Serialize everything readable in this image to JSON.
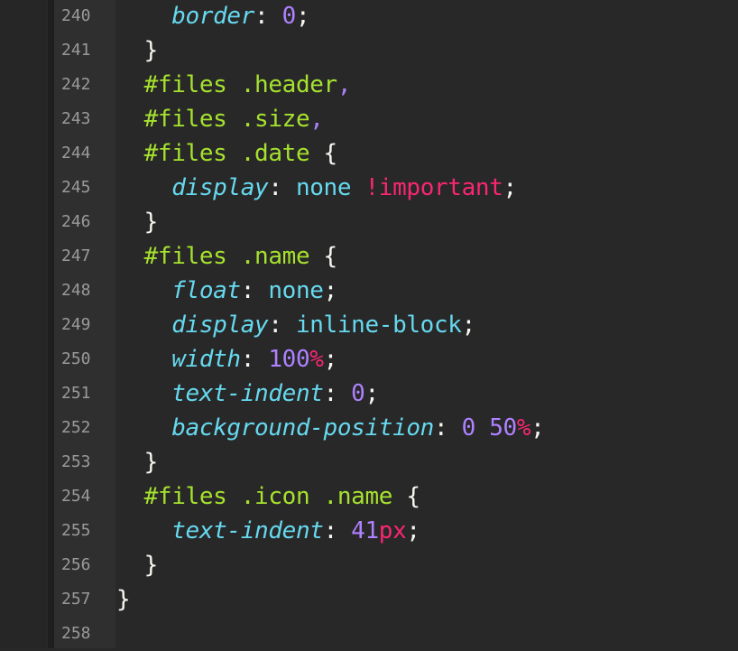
{
  "editor": {
    "colors": {
      "background": "#282828",
      "gutter": "#2f2f2f",
      "line_number": "#9a9a9a",
      "selector": "#a6e22e",
      "property": "#66d9ef",
      "number": "#ae81ff",
      "keyword": "#f92672",
      "punctuation": "#f8f8f2"
    },
    "lines": [
      {
        "num": "240",
        "indent": "    ",
        "tokens": [
          {
            "t": "prop",
            "v": "border"
          },
          {
            "t": "punc",
            "v": ": "
          },
          {
            "t": "num",
            "v": "0"
          },
          {
            "t": "punc",
            "v": ";"
          }
        ]
      },
      {
        "num": "241",
        "indent": "  ",
        "tokens": [
          {
            "t": "punc",
            "v": "}"
          }
        ]
      },
      {
        "num": "242",
        "indent": "  ",
        "tokens": [
          {
            "t": "sel",
            "v": "#files .header"
          },
          {
            "t": "comma",
            "v": ","
          }
        ]
      },
      {
        "num": "243",
        "indent": "  ",
        "tokens": [
          {
            "t": "sel",
            "v": "#files .size"
          },
          {
            "t": "comma",
            "v": ","
          }
        ]
      },
      {
        "num": "244",
        "indent": "  ",
        "tokens": [
          {
            "t": "sel",
            "v": "#files .date"
          },
          {
            "t": "punc",
            "v": " {"
          }
        ]
      },
      {
        "num": "245",
        "indent": "    ",
        "tokens": [
          {
            "t": "prop",
            "v": "display"
          },
          {
            "t": "punc",
            "v": ": "
          },
          {
            "t": "val",
            "v": "none"
          },
          {
            "t": "punc",
            "v": " "
          },
          {
            "t": "kw",
            "v": "!important"
          },
          {
            "t": "punc",
            "v": ";"
          }
        ]
      },
      {
        "num": "246",
        "indent": "  ",
        "tokens": [
          {
            "t": "punc",
            "v": "}"
          }
        ]
      },
      {
        "num": "247",
        "indent": "  ",
        "tokens": [
          {
            "t": "sel",
            "v": "#files .name"
          },
          {
            "t": "punc",
            "v": " {"
          }
        ]
      },
      {
        "num": "248",
        "indent": "    ",
        "tokens": [
          {
            "t": "prop",
            "v": "float"
          },
          {
            "t": "punc",
            "v": ": "
          },
          {
            "t": "val",
            "v": "none"
          },
          {
            "t": "punc",
            "v": ";"
          }
        ]
      },
      {
        "num": "249",
        "indent": "    ",
        "tokens": [
          {
            "t": "prop",
            "v": "display"
          },
          {
            "t": "punc",
            "v": ": "
          },
          {
            "t": "val",
            "v": "inline-block"
          },
          {
            "t": "punc",
            "v": ";"
          }
        ]
      },
      {
        "num": "250",
        "indent": "    ",
        "tokens": [
          {
            "t": "prop",
            "v": "width"
          },
          {
            "t": "punc",
            "v": ": "
          },
          {
            "t": "num",
            "v": "100"
          },
          {
            "t": "unit",
            "v": "%"
          },
          {
            "t": "punc",
            "v": ";"
          }
        ]
      },
      {
        "num": "251",
        "indent": "    ",
        "tokens": [
          {
            "t": "prop",
            "v": "text-indent"
          },
          {
            "t": "punc",
            "v": ": "
          },
          {
            "t": "num",
            "v": "0"
          },
          {
            "t": "punc",
            "v": ";"
          }
        ]
      },
      {
        "num": "252",
        "indent": "    ",
        "tokens": [
          {
            "t": "prop",
            "v": "background-position"
          },
          {
            "t": "punc",
            "v": ": "
          },
          {
            "t": "num",
            "v": "0"
          },
          {
            "t": "punc",
            "v": " "
          },
          {
            "t": "num",
            "v": "50"
          },
          {
            "t": "unit",
            "v": "%"
          },
          {
            "t": "punc",
            "v": ";"
          }
        ]
      },
      {
        "num": "253",
        "indent": "  ",
        "tokens": [
          {
            "t": "punc",
            "v": "}"
          }
        ]
      },
      {
        "num": "254",
        "indent": "  ",
        "tokens": [
          {
            "t": "sel",
            "v": "#files .icon .name"
          },
          {
            "t": "punc",
            "v": " {"
          }
        ]
      },
      {
        "num": "255",
        "indent": "    ",
        "tokens": [
          {
            "t": "prop",
            "v": "text-indent"
          },
          {
            "t": "punc",
            "v": ": "
          },
          {
            "t": "num",
            "v": "41"
          },
          {
            "t": "unit",
            "v": "px"
          },
          {
            "t": "punc",
            "v": ";"
          }
        ]
      },
      {
        "num": "256",
        "indent": "  ",
        "tokens": [
          {
            "t": "punc",
            "v": "}"
          }
        ]
      },
      {
        "num": "257",
        "indent": "",
        "tokens": [
          {
            "t": "punc",
            "v": "}"
          }
        ]
      },
      {
        "num": "258",
        "indent": "",
        "tokens": []
      }
    ]
  }
}
